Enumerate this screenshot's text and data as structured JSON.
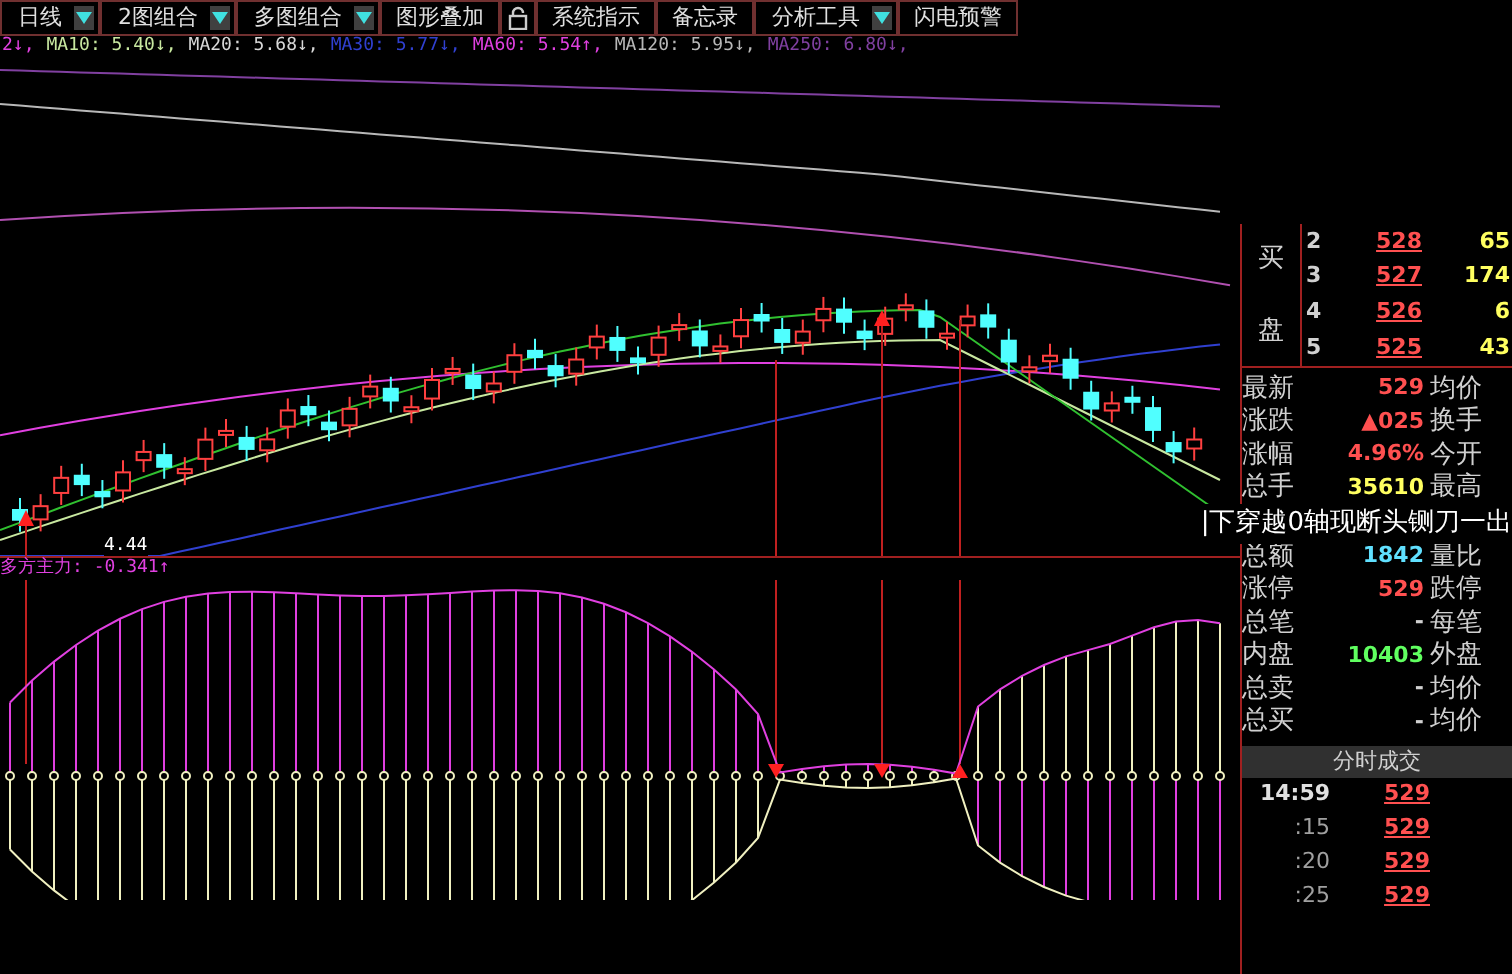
{
  "toolbar": [
    {
      "label": "日线",
      "kind": "dropdown"
    },
    {
      "label": "2图组合",
      "kind": "dropdown"
    },
    {
      "label": "多图组合",
      "kind": "dropdown"
    },
    {
      "label": "图形叠加",
      "kind": "plain"
    },
    {
      "kind": "lock"
    },
    {
      "label": "系统指示",
      "kind": "plain"
    },
    {
      "label": "备忘录",
      "kind": "plain"
    },
    {
      "label": "分析工具",
      "kind": "dropdown"
    },
    {
      "label": "闪电预警",
      "kind": "plain"
    }
  ],
  "ma_legend": [
    {
      "text": "2↓,",
      "color": "#e040e0"
    },
    {
      "text": "MA10: 5.40↓,",
      "color": "#c8e8a0"
    },
    {
      "text": "MA20: 5.68↓,",
      "color": "#d8d8d8"
    },
    {
      "text": "MA30: 5.77↓,",
      "color": "#3040d0"
    },
    {
      "text": "MA60: 5.54↑,",
      "color": "#e040e0"
    },
    {
      "text": "MA120: 5.95↓,",
      "color": "#b8b8b8"
    },
    {
      "text": "MA250: 6.80↓,",
      "color": "#8040a0"
    }
  ],
  "main_chart": {
    "low_marker": "4.44"
  },
  "indicator": {
    "label": "多方主力: -0.341↑"
  },
  "annotation": "|下穿越0轴现断头铡刀一出",
  "order_book": {
    "side_labels": [
      "买",
      "盘"
    ],
    "rows": [
      {
        "rank": "2",
        "price": "528",
        "volume": "65"
      },
      {
        "rank": "3",
        "price": "527",
        "volume": "174"
      },
      {
        "rank": "4",
        "price": "526",
        "volume": "6"
      },
      {
        "rank": "5",
        "price": "525",
        "volume": "43"
      }
    ]
  },
  "stats_top": [
    {
      "label": "最新",
      "value": "529",
      "color": "#ff5050",
      "right_label": "均价"
    },
    {
      "label": "涨跌",
      "value": "▲025",
      "color": "#ff5050",
      "right_label": "换手"
    },
    {
      "label": "涨幅",
      "value": "4.96%",
      "color": "#ff5050",
      "right_label": "今开"
    },
    {
      "label": "总手",
      "value": "35610",
      "color": "#ffff60",
      "right_label": "最高"
    }
  ],
  "stats_bottom": [
    {
      "label": "总额",
      "value": "1842",
      "color": "#60e0ff",
      "right_label": "量比"
    },
    {
      "label": "涨停",
      "value": "529",
      "color": "#ff5050",
      "right_label": "跌停"
    },
    {
      "label": "总笔",
      "value": "-",
      "color": "#d0d0d0",
      "right_label": "每笔"
    },
    {
      "label": "内盘",
      "value": "10403",
      "color": "#60ff60",
      "right_label": "外盘"
    },
    {
      "label": "总卖",
      "value": "-",
      "color": "#d0d0d0",
      "right_label": "均价"
    },
    {
      "label": "总买",
      "value": "-",
      "color": "#d0d0d0",
      "right_label": "均价"
    }
  ],
  "ticks": {
    "header": "分时成交",
    "rows": [
      {
        "time": "14:59",
        "price": "529"
      },
      {
        "time": ":15",
        "price": "529"
      },
      {
        "time": ":20",
        "price": "529"
      },
      {
        "time": ":25",
        "price": "529"
      }
    ]
  }
}
